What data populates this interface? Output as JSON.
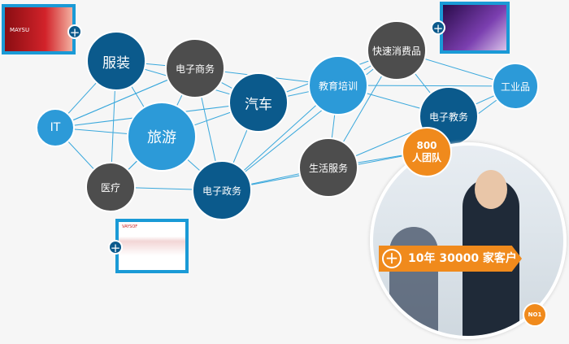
{
  "nodes": [
    {
      "label": "服装",
      "color": "#0b5a8c"
    },
    {
      "label": "电子商务",
      "color": "#4d4d4d"
    },
    {
      "label": "IT",
      "color": "#2c9ad8"
    },
    {
      "label": "旅游",
      "color": "#2c9ad8"
    },
    {
      "label": "汽车",
      "color": "#0b5a8c"
    },
    {
      "label": "医疗",
      "color": "#4d4d4d"
    },
    {
      "label": "电子政务",
      "color": "#0b5a8c"
    },
    {
      "label": "教育培训",
      "color": "#2c9ad8"
    },
    {
      "label": "快速消费品",
      "color": "#4d4d4d"
    },
    {
      "label": "生活服务",
      "color": "#4d4d4d"
    },
    {
      "label": "电子教务",
      "color": "#0b5a8c"
    },
    {
      "label": "工业品",
      "color": "#2c9ad8"
    }
  ],
  "team": {
    "line1": "800",
    "line2": "人团队"
  },
  "banner": {
    "text": "10年 30000 家客户"
  },
  "badge": "NO1",
  "thumbnails": [
    {
      "brand": "MAYSU"
    },
    {
      "brand": ""
    },
    {
      "brand": "VAYSOF"
    }
  ],
  "colors": {
    "accent": "#f08a1c",
    "line": "#3aa8dc"
  }
}
